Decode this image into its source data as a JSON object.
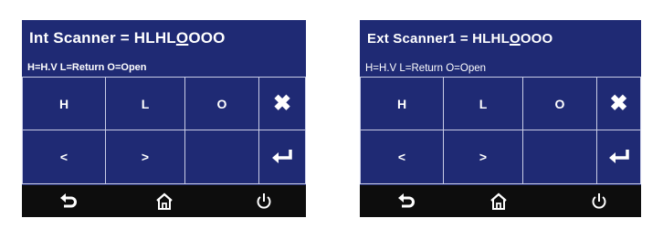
{
  "int_screen": {
    "title_prefix": "Int Scanner = HLHL",
    "title_cursor": "O",
    "title_suffix": "OOO",
    "legend": "H=H.V  L=Return  O=Open",
    "keys": {
      "h": "H",
      "l": "L",
      "o": "O",
      "less": "<",
      "greater": ">",
      "cancel": "✖",
      "enter": "↵"
    }
  },
  "ext_screen": {
    "title_prefix": "Ext Scanner1 = HLHL",
    "title_cursor": "O",
    "title_suffix": "OOO",
    "legend": "H=H.V  L=Return  O=Open",
    "keys": {
      "h": "H",
      "l": "L",
      "o": "O",
      "less": "<",
      "greater": ">",
      "cancel": "✖",
      "enter": "↵"
    }
  },
  "colors": {
    "screen_bg": "#1f2a74",
    "grid_line": "#c9cde6",
    "nav_bg": "#0d0d0d",
    "text": "#ffffff"
  },
  "icons": [
    "back-icon",
    "home-icon",
    "power-icon",
    "close-icon",
    "enter-icon"
  ]
}
